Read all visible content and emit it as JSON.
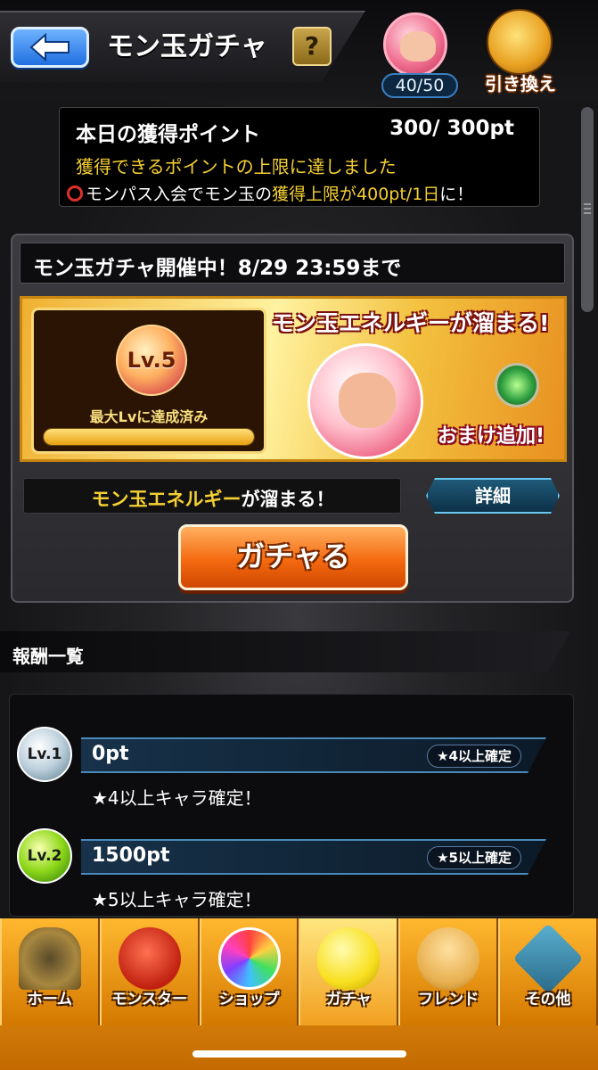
{
  "header": {
    "title": "モン玉ガチャ",
    "help_symbol": "?",
    "monball_count": "40/50",
    "exchange_label": "引き換え"
  },
  "points": {
    "label": "本日の獲得ポイント",
    "value": "300/ 300pt",
    "limit_message": "獲得できるポイントの上限に達しました",
    "promo_prefix": "モンパス入会でモン玉の",
    "promo_highlight": "獲得上限が400pt/1日",
    "promo_suffix": "に！"
  },
  "gacha": {
    "event_title": "モン玉ガチャ開催中！8/29 23:59まで",
    "level": "Lv.5",
    "level_status": "最大Lvに達成済み",
    "level_progress": 1.0,
    "banner_headline": "モン玉エネルギーが溜まる!",
    "bonus_label": "おまけ追加!",
    "energy_highlight": "モン玉エネルギー",
    "energy_suffix": "が溜まる！",
    "detail_label": "詳細",
    "gacha_button": "ガチャる"
  },
  "rewards": {
    "title": "報酬一覧",
    "items": [
      {
        "level": "Lv.1",
        "points": "0pt",
        "tag": "★4以上確定",
        "description": "★4以上キャラ確定！",
        "orb_color": "silver"
      },
      {
        "level": "Lv.2",
        "points": "1500pt",
        "tag": "★5以上確定",
        "description": "★5以上キャラ確定！",
        "orb_color": "green"
      }
    ]
  },
  "nav": [
    {
      "label": "ホーム",
      "icon": "home-gate-icon"
    },
    {
      "label": "モンスター",
      "icon": "dragon-icon"
    },
    {
      "label": "ショップ",
      "icon": "rainbow-orb-icon"
    },
    {
      "label": "ガチャ",
      "icon": "gacha-egg-icon",
      "active": true
    },
    {
      "label": "フレンド",
      "icon": "friends-icon"
    },
    {
      "label": "その他",
      "icon": "other-icon"
    }
  ]
}
